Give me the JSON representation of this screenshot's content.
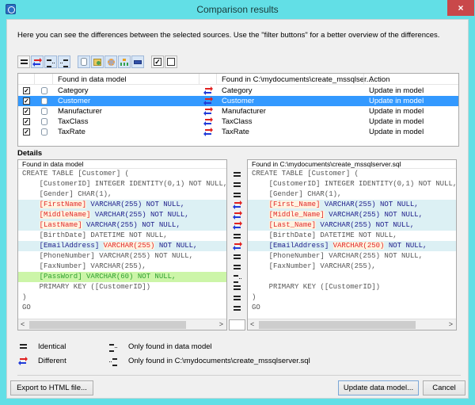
{
  "window": {
    "title": "Comparison results",
    "close_label": "×"
  },
  "intro_text": "Here you can see the differences between the selected sources. Use the \"filter buttons\" for a better overview of the differences.",
  "toolbar": {
    "buttons": [
      {
        "icon": "identical-filter-icon",
        "pressed": false
      },
      {
        "icon": "different-filter-icon",
        "pressed": true
      },
      {
        "icon": "only-left-filter-icon",
        "pressed": true
      },
      {
        "icon": "only-right-filter-icon",
        "pressed": true
      },
      {
        "icon": "table-filter-icon",
        "pressed": true
      },
      {
        "icon": "view-filter-icon",
        "pressed": true
      },
      {
        "icon": "procedure-filter-icon",
        "pressed": true
      },
      {
        "icon": "relation-filter-icon",
        "pressed": true
      },
      {
        "icon": "sequence-filter-icon",
        "pressed": true
      },
      {
        "icon": "check-all-icon",
        "pressed": false
      },
      {
        "icon": "uncheck-all-icon",
        "pressed": false
      }
    ]
  },
  "object_list": {
    "columns": {
      "left": "Found in data model",
      "right": "Found in C:\\mydocuments\\create_mssqlser...",
      "action": "Action"
    },
    "rows": [
      {
        "checked": true,
        "left": "Category",
        "status": "different",
        "right": "Category",
        "action": "Update in model",
        "selected": false
      },
      {
        "checked": true,
        "left": "Customer",
        "status": "different",
        "right": "Customer",
        "action": "Update in model",
        "selected": true
      },
      {
        "checked": true,
        "left": "Manufacturer",
        "status": "different",
        "right": "Manufacturer",
        "action": "Update in model",
        "selected": false
      },
      {
        "checked": true,
        "left": "TaxClass",
        "status": "different",
        "right": "TaxClass",
        "action": "Update in model",
        "selected": false
      },
      {
        "checked": true,
        "left": "TaxRate",
        "status": "different",
        "right": "TaxRate",
        "action": "Update in model",
        "selected": false
      }
    ]
  },
  "details": {
    "label": "Details",
    "left_header": "Found in data model",
    "right_header": "Found in C:\\mydocuments\\create_mssqlserver.sql",
    "lines": [
      {
        "status": "identical",
        "left": [
          {
            "t": "CREATE TABLE [Customer] (",
            "c": "gray"
          }
        ],
        "right": [
          {
            "t": "CREATE TABLE [Customer] (",
            "c": "gray"
          }
        ]
      },
      {
        "status": "identical",
        "left": [
          {
            "t": "    [CustomerID] INTEGER IDENTITY(0,1) NOT NULL,",
            "c": "gray"
          }
        ],
        "right": [
          {
            "t": "    [CustomerID] INTEGER IDENTITY(0,1) NOT NULL,",
            "c": "gray"
          }
        ]
      },
      {
        "status": "identical",
        "left": [
          {
            "t": "    [Gender] CHAR(1),",
            "c": "gray"
          }
        ],
        "right": [
          {
            "t": "    [Gender] CHAR(1),",
            "c": "gray"
          }
        ]
      },
      {
        "status": "different",
        "left": [
          {
            "t": "    ",
            "c": ""
          },
          {
            "t": "[FirstName]",
            "c": "red"
          },
          {
            "t": " VARCHAR(255) NOT NULL,",
            "c": ""
          }
        ],
        "right": [
          {
            "t": "    ",
            "c": ""
          },
          {
            "t": "[First_Name]",
            "c": "red"
          },
          {
            "t": " VARCHAR(255) NOT NULL,",
            "c": ""
          }
        ]
      },
      {
        "status": "different",
        "left": [
          {
            "t": "    ",
            "c": ""
          },
          {
            "t": "[MiddleName]",
            "c": "red"
          },
          {
            "t": " VARCHAR(255) NOT NULL,",
            "c": ""
          }
        ],
        "right": [
          {
            "t": "    ",
            "c": ""
          },
          {
            "t": "[Middle_Name]",
            "c": "red"
          },
          {
            "t": " VARCHAR(255) NOT NULL,",
            "c": ""
          }
        ]
      },
      {
        "status": "different",
        "left": [
          {
            "t": "    ",
            "c": ""
          },
          {
            "t": "[LastName]",
            "c": "red"
          },
          {
            "t": " VARCHAR(255) NOT NULL,",
            "c": ""
          }
        ],
        "right": [
          {
            "t": "    ",
            "c": ""
          },
          {
            "t": "[Last_Name]",
            "c": "red"
          },
          {
            "t": " VARCHAR(255) NOT NULL,",
            "c": ""
          }
        ]
      },
      {
        "status": "identical",
        "left": [
          {
            "t": "    [BirthDate] DATETIME NOT NULL,",
            "c": "gray"
          }
        ],
        "right": [
          {
            "t": "    [BirthDate] DATETIME NOT NULL,",
            "c": "gray"
          }
        ]
      },
      {
        "status": "different",
        "left": [
          {
            "t": "    [EmailAddress] ",
            "c": ""
          },
          {
            "t": "VARCHAR(255)",
            "c": "red"
          },
          {
            "t": " NOT NULL,",
            "c": ""
          }
        ],
        "right": [
          {
            "t": "    [EmailAddress] ",
            "c": ""
          },
          {
            "t": "VARCHAR(250)",
            "c": "red"
          },
          {
            "t": " NOT NULL,",
            "c": ""
          }
        ]
      },
      {
        "status": "identical",
        "left": [
          {
            "t": "    [PhoneNumber] VARCHAR(255) NOT NULL,",
            "c": "gray"
          }
        ],
        "right": [
          {
            "t": "    [PhoneNumber] VARCHAR(255) NOT NULL,",
            "c": "gray"
          }
        ]
      },
      {
        "status": "identical",
        "left": [
          {
            "t": "    [FaxNumber] VARCHAR(255),",
            "c": "gray"
          }
        ],
        "right": [
          {
            "t": "    [FaxNumber] VARCHAR(255),",
            "c": "gray"
          }
        ]
      },
      {
        "status": "only-left",
        "left": [
          {
            "t": "    [PassWord] VARCHAR(60) NOT NULL,",
            "c": "green"
          }
        ],
        "right": [
          {
            "t": "",
            "c": ""
          }
        ]
      },
      {
        "status": "identical",
        "left": [
          {
            "t": "    PRIMARY KEY ([CustomerID])",
            "c": "gray"
          }
        ],
        "right": [
          {
            "t": "    PRIMARY KEY ([CustomerID])",
            "c": "gray"
          }
        ]
      },
      {
        "status": "identical",
        "left": [
          {
            "t": ")",
            "c": "gray"
          }
        ],
        "right": [
          {
            "t": ")",
            "c": "gray"
          }
        ]
      },
      {
        "status": "identical",
        "left": [
          {
            "t": "GO",
            "c": "gray"
          }
        ],
        "right": [
          {
            "t": "GO",
            "c": "gray"
          }
        ]
      }
    ]
  },
  "legend": {
    "identical": "Identical",
    "different": "Different",
    "only_left": "Only found in data model",
    "only_right": "Only found in C:\\mydocuments\\create_mssqlserver.sql"
  },
  "buttons": {
    "export": "Export to HTML file...",
    "update": "Update data model...",
    "cancel": "Cancel"
  },
  "colors": {
    "selection": "#3399ff",
    "diff_row": "#dcf0f4",
    "only_row": "#ccf5a8",
    "diff_text": "#e02a2a",
    "keyword_text": "#1d1d8a"
  }
}
